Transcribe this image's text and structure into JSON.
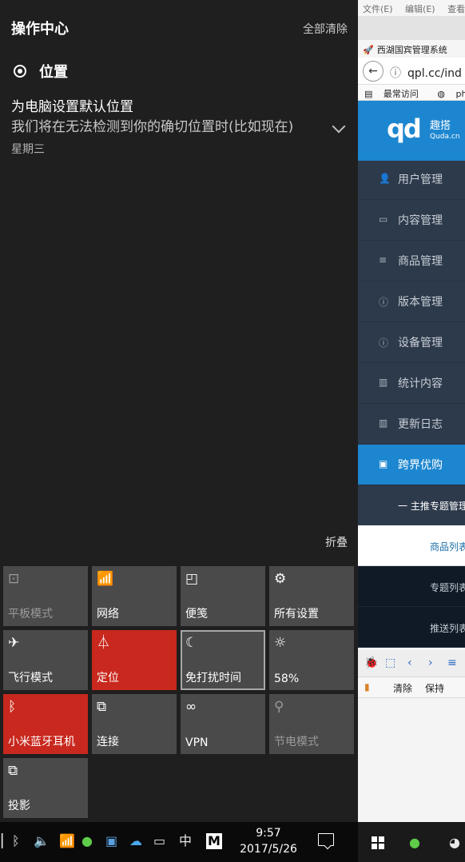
{
  "action_center": {
    "title": "操作中心",
    "clear_all": "全部清除",
    "group": {
      "label": "位置",
      "icon": "location-radio-icon"
    },
    "notification": {
      "title": "为电脑设置默认位置",
      "body": "我们将在无法检测到你的确切位置时(比如现在)",
      "time": "星期三"
    },
    "collapse": "折叠",
    "tiles": [
      {
        "label": "平板模式",
        "icon": "tablet-mode-icon",
        "glyph": "⊡",
        "state": "dim"
      },
      {
        "label": "网络",
        "icon": "network-icon",
        "glyph": "📶",
        "state": "off"
      },
      {
        "label": "便笺",
        "icon": "note-icon",
        "glyph": "◰",
        "state": "off"
      },
      {
        "label": "所有设置",
        "icon": "settings-gear-icon",
        "glyph": "⚙",
        "state": "off"
      },
      {
        "label": "飞行模式",
        "icon": "airplane-icon",
        "glyph": "✈",
        "state": "off"
      },
      {
        "label": "定位",
        "icon": "location-icon",
        "glyph": "⏃",
        "state": "on"
      },
      {
        "label": "免打扰时间",
        "icon": "moon-icon",
        "glyph": "☾",
        "state": "selected"
      },
      {
        "label": "58%",
        "icon": "brightness-icon",
        "glyph": "☼",
        "state": "off"
      },
      {
        "label": "小米蓝牙耳机",
        "icon": "bluetooth-icon",
        "glyph": "ᛒ",
        "state": "on"
      },
      {
        "label": "连接",
        "icon": "connect-icon",
        "glyph": "⧉",
        "state": "off"
      },
      {
        "label": "VPN",
        "icon": "vpn-icon",
        "glyph": "∞",
        "state": "off"
      },
      {
        "label": "节电模式",
        "icon": "battery-saver-icon",
        "glyph": "⚲",
        "state": "dim"
      },
      {
        "label": "投影",
        "icon": "project-icon",
        "glyph": "⧉",
        "state": "off"
      }
    ]
  },
  "taskbar": {
    "time": "9:57",
    "date": "2017/5/26",
    "ime": "中",
    "tray": [
      "bluetooth-tray-icon",
      "volume-icon",
      "wifi-icon",
      "wechat-tray-icon",
      "computer-tray-icon",
      "cloud-tray-icon",
      "battery-tray-icon"
    ]
  },
  "browser": {
    "menu": [
      "文件(E)",
      "编辑(E)",
      "查看"
    ],
    "tab_title": "西湖国宾管理系统",
    "url": "qpl.cc/ind",
    "bookmarks": [
      "最常访问",
      "phpi"
    ],
    "logo": {
      "mark": "qd",
      "cn": "趣搭",
      "en": "Quda.cn"
    },
    "sidebar": [
      {
        "label": "用户管理",
        "glyph": "👤"
      },
      {
        "label": "内容管理",
        "glyph": "▭"
      },
      {
        "label": "商品管理",
        "glyph": "≡"
      },
      {
        "label": "版本管理",
        "glyph": "ⓘ"
      },
      {
        "label": "设备管理",
        "glyph": "ⓘ"
      },
      {
        "label": "统计内容",
        "glyph": "▥"
      },
      {
        "label": "更新日志",
        "glyph": "▥"
      },
      {
        "label": "跨界优购",
        "glyph": "▣"
      }
    ],
    "sub_item": "一  主推专题管理",
    "list": [
      "商品列表",
      "专题列表",
      "推送列表"
    ],
    "devtools": {
      "clear": "清除",
      "keep": "保持"
    }
  }
}
